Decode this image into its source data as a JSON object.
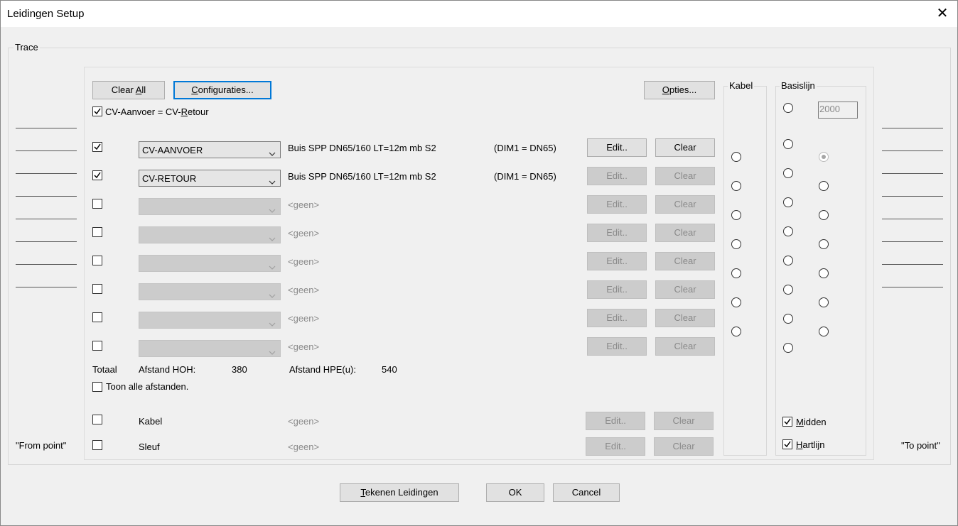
{
  "window": {
    "title": "Leidingen Setup",
    "close_icon": "close-icon"
  },
  "trace": {
    "label": "Trace",
    "from_point": "\"From point\"",
    "to_point": "\"To point\""
  },
  "toolbar": {
    "clear_all": "Clear All",
    "configuraties": "Configuraties...",
    "opties": "Opties..."
  },
  "cv_equal": {
    "label": "CV-Aanvoer = CV-Retour",
    "checked": true
  },
  "pipes": [
    {
      "checked": true,
      "combo": "CV-AANVOER",
      "desc": "Buis SPP DN65/160 LT=12m mb S2",
      "dim": "(DIM1 = DN65)",
      "edit": "Edit..",
      "clear": "Clear",
      "enabled": true
    },
    {
      "checked": true,
      "combo": "CV-RETOUR",
      "desc": "Buis SPP DN65/160 LT=12m mb S2",
      "dim": "(DIM1 = DN65)",
      "edit": "Edit..",
      "clear": "Clear",
      "enabled": false
    },
    {
      "checked": false,
      "combo": "",
      "desc": "<geen>",
      "dim": "",
      "edit": "Edit..",
      "clear": "Clear",
      "enabled": false
    },
    {
      "checked": false,
      "combo": "",
      "desc": "<geen>",
      "dim": "",
      "edit": "Edit..",
      "clear": "Clear",
      "enabled": false
    },
    {
      "checked": false,
      "combo": "",
      "desc": "<geen>",
      "dim": "",
      "edit": "Edit..",
      "clear": "Clear",
      "enabled": false
    },
    {
      "checked": false,
      "combo": "",
      "desc": "<geen>",
      "dim": "",
      "edit": "Edit..",
      "clear": "Clear",
      "enabled": false
    },
    {
      "checked": false,
      "combo": "",
      "desc": "<geen>",
      "dim": "",
      "edit": "Edit..",
      "clear": "Clear",
      "enabled": false
    },
    {
      "checked": false,
      "combo": "",
      "desc": "<geen>",
      "dim": "",
      "edit": "Edit..",
      "clear": "Clear",
      "enabled": false
    }
  ],
  "totals": {
    "label": "Totaal",
    "hoh_label": "Afstand HOH:",
    "hoh_value": "380",
    "hpe_label": "Afstand HPE(u):",
    "hpe_value": "540"
  },
  "show_all": {
    "label": "Toon alle afstanden.",
    "checked": false
  },
  "extra_rows": [
    {
      "checked": false,
      "label": "Kabel",
      "desc": "<geen>",
      "edit": "Edit..",
      "clear": "Clear"
    },
    {
      "checked": false,
      "label": "Sleuf",
      "desc": "<geen>",
      "edit": "Edit..",
      "clear": "Clear"
    }
  ],
  "kabel_group": {
    "label": "Kabel"
  },
  "basislijn_group": {
    "label": "Basislijn",
    "value": "2000",
    "selected_index": 0
  },
  "midden": {
    "label": "Midden",
    "checked": true
  },
  "hartlijn": {
    "label": "Hartlijn",
    "checked": true
  },
  "footer": {
    "tekenen": "Tekenen Leidingen",
    "ok": "OK",
    "cancel": "Cancel"
  }
}
